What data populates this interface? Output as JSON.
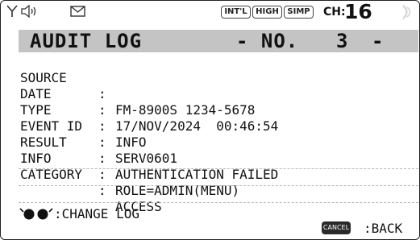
{
  "status_bar": {
    "badges": [
      "INT'L",
      "HIGH",
      "SIMP"
    ],
    "channel_label": "CH:",
    "channel_number": "16"
  },
  "title": {
    "left": "AUDIT LOG",
    "middle": "- NO.",
    "number": "3",
    "right": "-"
  },
  "fields": [
    {
      "label": "SOURCE",
      "sep": ":",
      "value": "FM-8900S 1234-5678"
    },
    {
      "label": "DATE",
      "sep": ":",
      "value": "17/NOV/2024  00:46:54"
    },
    {
      "label": "TYPE",
      "sep": ":",
      "value": "INFO"
    },
    {
      "label": "EVENT ID",
      "sep": ":",
      "value": "SERV0601"
    },
    {
      "label": "RESULT",
      "sep": ":",
      "value": "AUTHENTICATION FAILED"
    },
    {
      "label": "INFO",
      "sep": ":",
      "value": "ROLE=ADMIN(MENU)"
    },
    {
      "label": "CATEGORY",
      "sep": ":",
      "value": "ACCESS"
    }
  ],
  "footer": {
    "hint": ":CHANGE LOG",
    "cancel_key": "CANCEL",
    "back_label": ":BACK"
  }
}
